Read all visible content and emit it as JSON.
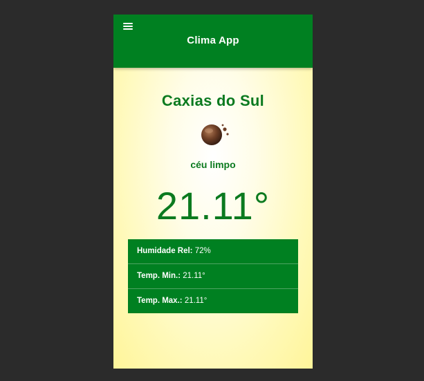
{
  "appbar": {
    "title": "Clima App",
    "menu_icon": "hamburger-menu-icon"
  },
  "weather": {
    "city": "Caxias do Sul",
    "icon": "clear-sky-night-icon",
    "condition": "céu limpo",
    "temperature": "21.11°"
  },
  "details": [
    {
      "label": "Humidade Rel:",
      "value": "72%"
    },
    {
      "label": "Temp. Min.:",
      "value": "21.11°"
    },
    {
      "label": "Temp. Max.:",
      "value": "21.11°"
    }
  ],
  "colors": {
    "primary_green": "#008021",
    "text_green": "#0b7a1f",
    "background": "#fff59a",
    "page_background": "#2b2b2b"
  }
}
